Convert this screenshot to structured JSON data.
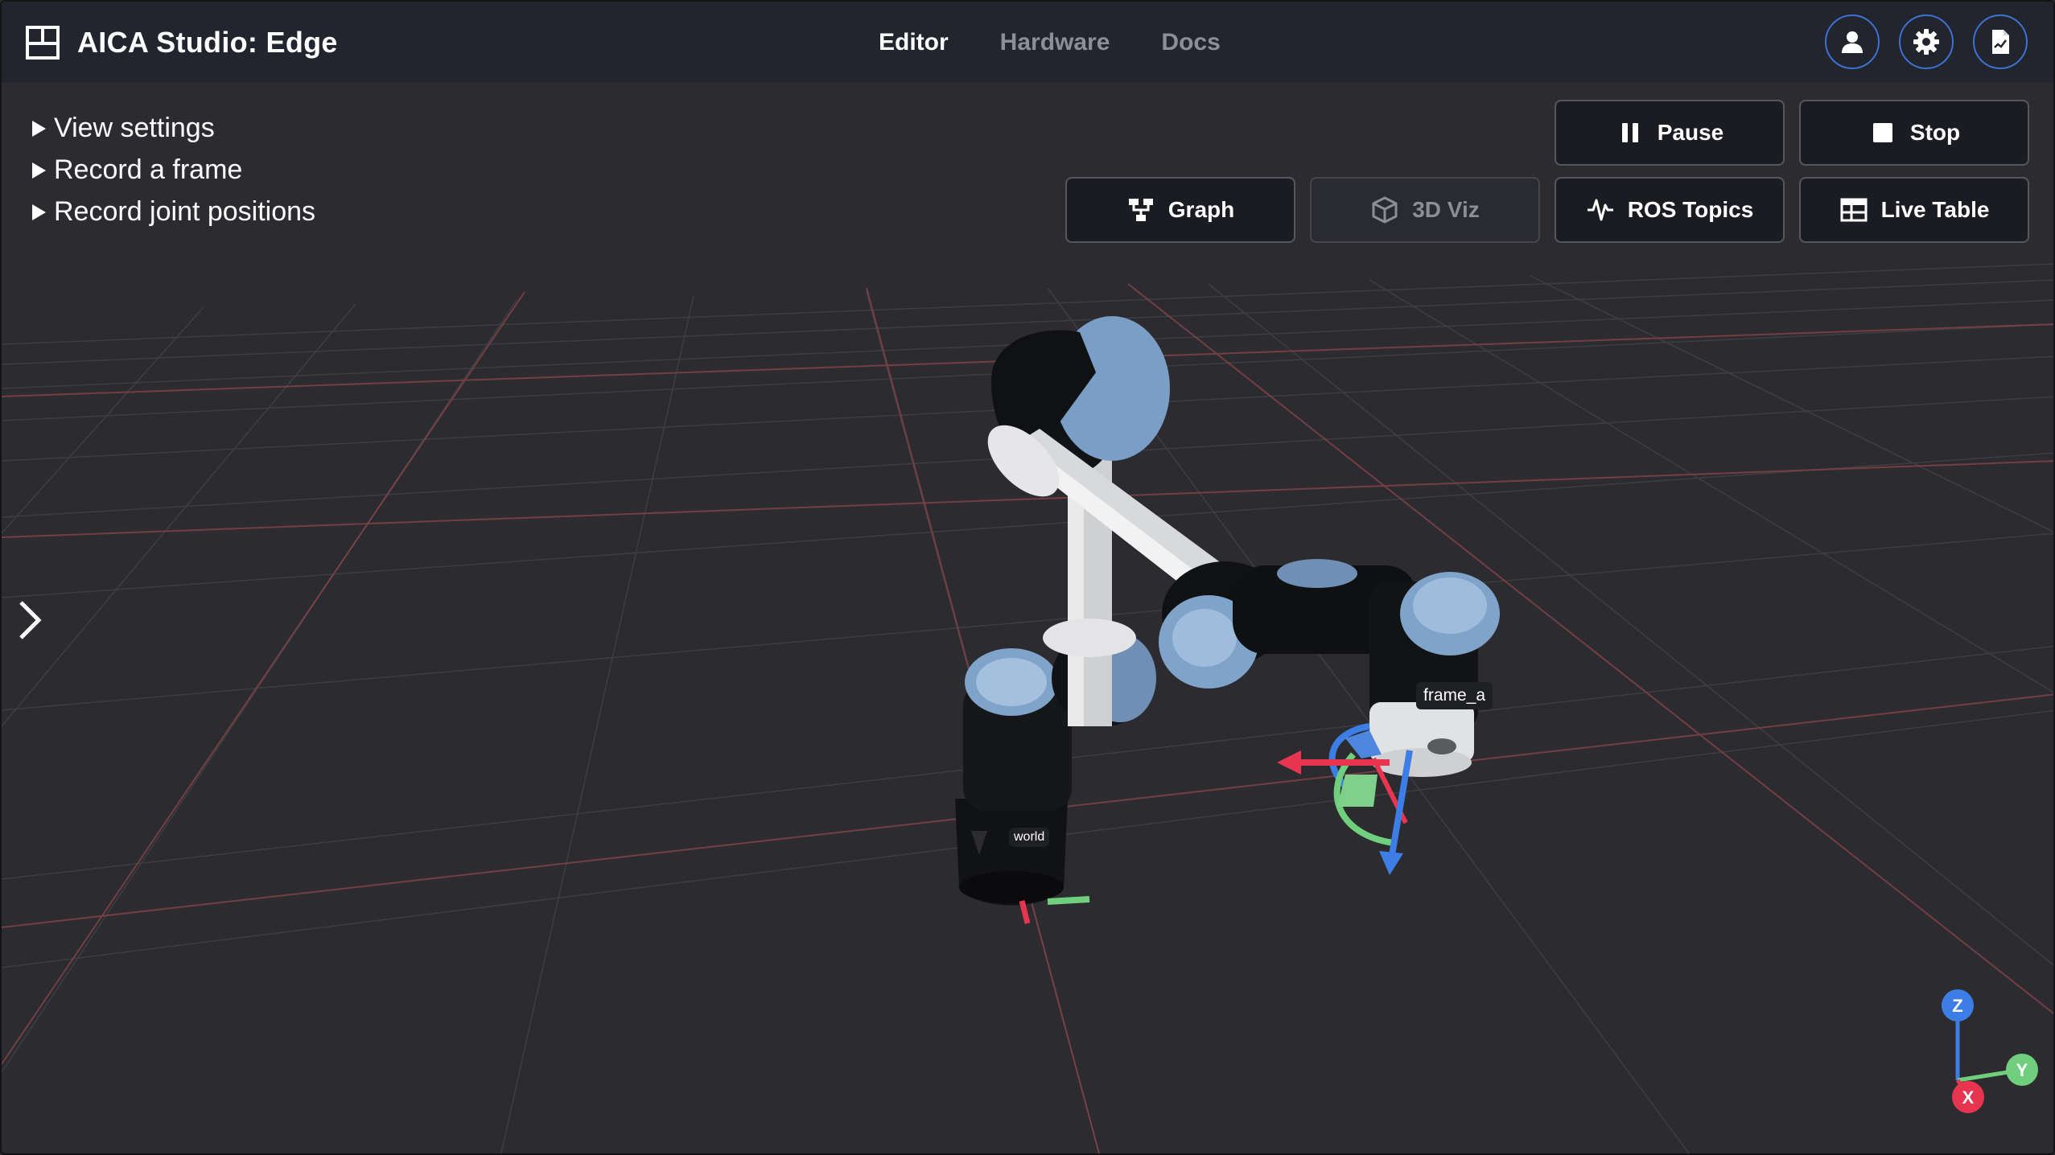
{
  "app": {
    "title": "AICA Studio: Edge",
    "logo_icon": "grid-layout-icon"
  },
  "nav": {
    "tabs": [
      {
        "label": "Editor",
        "active": true
      },
      {
        "label": "Hardware",
        "active": false
      },
      {
        "label": "Docs",
        "active": false
      }
    ]
  },
  "header_actions": {
    "account_icon": "user-icon",
    "settings_icon": "gear-icon",
    "export_icon": "document-chart-icon"
  },
  "settings_panel": {
    "items": [
      {
        "label": "View settings"
      },
      {
        "label": "Record a frame"
      },
      {
        "label": "Record joint positions"
      }
    ]
  },
  "controls": {
    "pause": {
      "label": "Pause",
      "icon": "pause-icon"
    },
    "stop": {
      "label": "Stop",
      "icon": "stop-icon"
    }
  },
  "views": {
    "graph": {
      "label": "Graph",
      "icon": "graph-icon"
    },
    "viz3d": {
      "label": "3D Viz",
      "icon": "cube-icon",
      "disabled": true
    },
    "ros_topics": {
      "label": "ROS Topics",
      "icon": "waveform-icon"
    },
    "live_table": {
      "label": "Live Table",
      "icon": "table-icon"
    }
  },
  "scene": {
    "frame_labels": {
      "world": "world",
      "frame_a": "frame_a"
    },
    "axes": {
      "z": "Z",
      "y": "Y",
      "x": "X"
    }
  },
  "colors": {
    "header_bg": "#23252e",
    "viewport_bg": "#2c2c30",
    "accent_blue": "#3d72d4",
    "grid_red": "#8a4549",
    "axis_x": "#e8354f",
    "axis_y": "#6fcf7c",
    "axis_z": "#3d7ee6"
  }
}
